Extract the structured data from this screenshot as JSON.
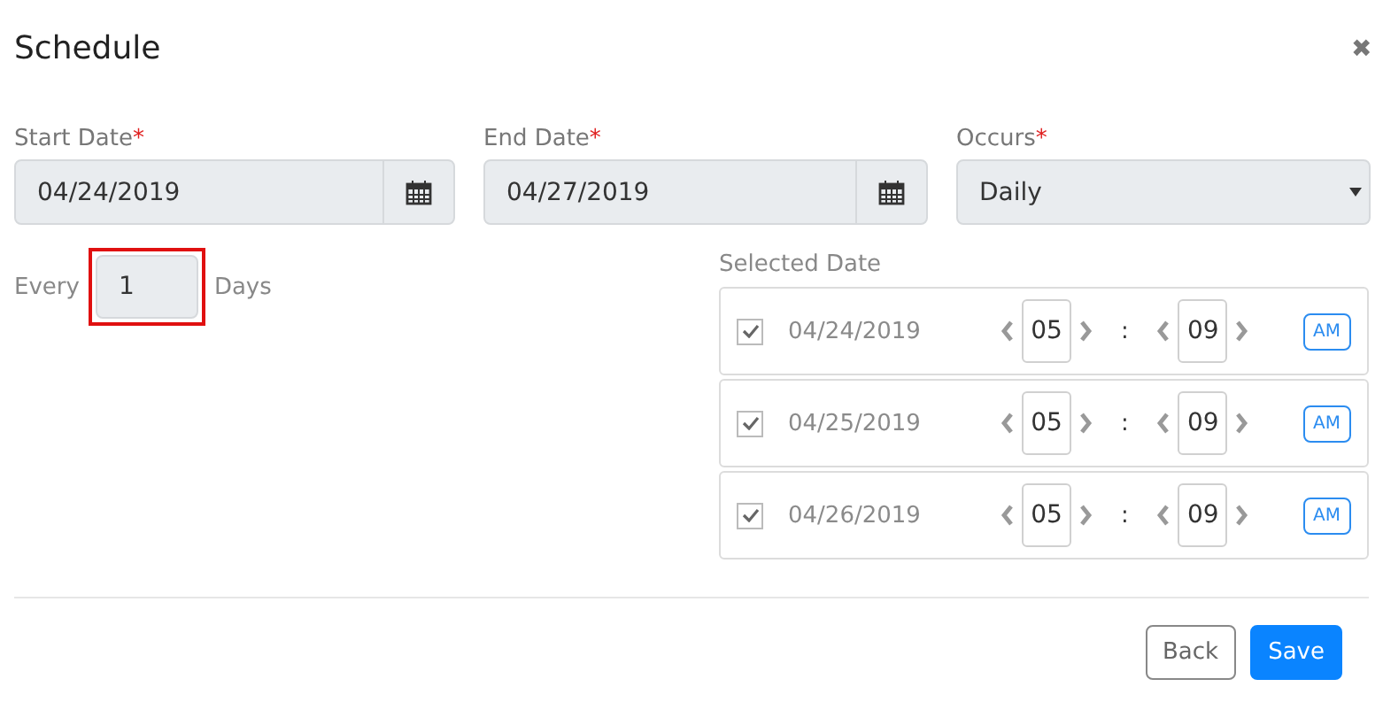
{
  "dialog": {
    "title": "Schedule",
    "close": "✖"
  },
  "fields": [
    {
      "kind": "date",
      "label": "Start Date",
      "required_mark": "*",
      "value": "04/24/2019"
    },
    {
      "kind": "date",
      "label": "End Date",
      "required_mark": "*",
      "value": "04/27/2019"
    },
    {
      "kind": "select",
      "label": "Occurs",
      "required_mark": "*",
      "value": "Daily"
    }
  ],
  "every": {
    "prefix": "Every",
    "value": "1",
    "suffix": "Days",
    "highlighted": true
  },
  "selected_dates": {
    "label": "Selected Date",
    "separator": ":",
    "rows": [
      {
        "checked": true,
        "date": "04/24/2019",
        "hour": "05",
        "minute": "09",
        "period": "AM"
      },
      {
        "checked": true,
        "date": "04/25/2019",
        "hour": "05",
        "minute": "09",
        "period": "AM"
      },
      {
        "checked": true,
        "date": "04/26/2019",
        "hour": "05",
        "minute": "09",
        "period": "AM"
      }
    ]
  },
  "buttons": [
    {
      "kind": "secondary",
      "label": "Back"
    },
    {
      "kind": "primary",
      "label": "Save"
    }
  ]
}
